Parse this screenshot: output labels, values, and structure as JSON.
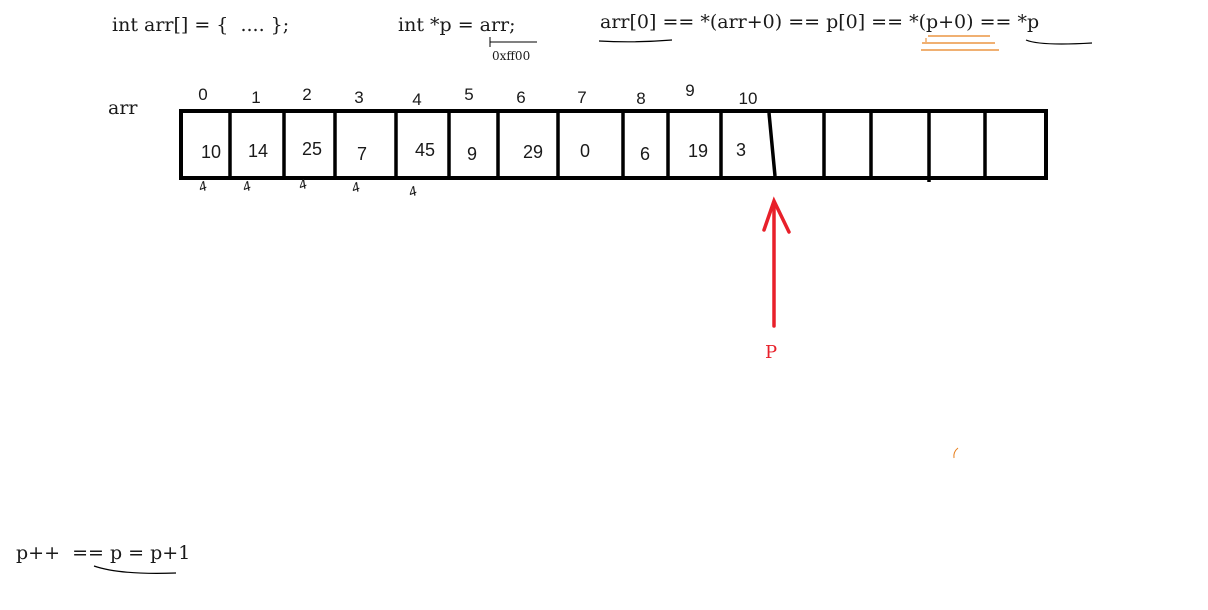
{
  "code": {
    "decl_arr": "int arr[] = {  .... };",
    "decl_ptr": "int *p = arr;",
    "addr": "0xff00",
    "equiv": "arr[0] == *(arr+0) == p[0] == *(p+0) == *p",
    "incr": "p++  == p = p+1"
  },
  "array": {
    "name": "arr",
    "indices": [
      "0",
      "1",
      "2",
      "3",
      "4",
      "5",
      "6",
      "7",
      "8",
      "9",
      "10"
    ],
    "values": [
      "10",
      "14",
      "25",
      "7",
      "45",
      "9",
      "29",
      "0",
      "6",
      "19",
      "3"
    ],
    "marks": [
      "4",
      "4",
      "4",
      "4",
      "4"
    ]
  },
  "pointer": {
    "label": "P",
    "color": "#e8202a"
  },
  "accent": {
    "underline_orange": "#e8801e",
    "ink": "#000000"
  }
}
